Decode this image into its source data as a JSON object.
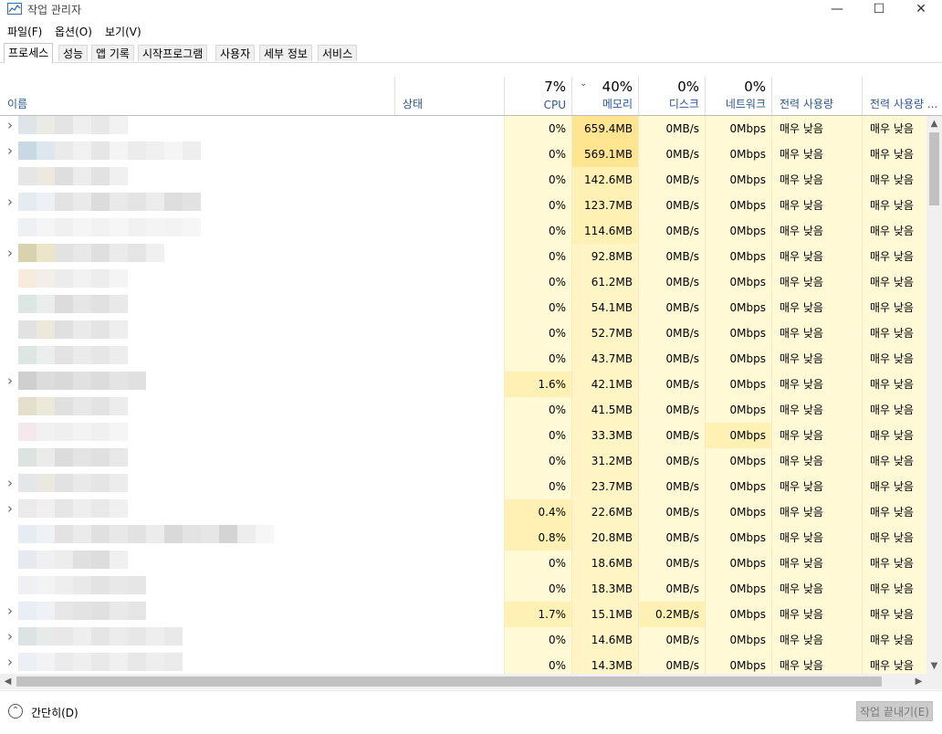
{
  "window": {
    "title": "작업 관리자"
  },
  "menu": [
    "파일(F)",
    "옵션(O)",
    "보기(V)"
  ],
  "tabs": [
    "프로세스",
    "성능",
    "앱 기록",
    "시작프로그램",
    "사용자",
    "세부 정보",
    "서비스"
  ],
  "active_tab": 0,
  "columns": {
    "name": "이름",
    "status": "상태",
    "cpu": {
      "pct": "7%",
      "label": "CPU"
    },
    "memory": {
      "pct": "40%",
      "label": "메모리"
    },
    "disk": {
      "pct": "0%",
      "label": "디스크"
    },
    "network": {
      "pct": "0%",
      "label": "네트워크"
    },
    "power": "전력 사용량",
    "power_trend": "전력 사용량 ..."
  },
  "rows": [
    {
      "expand": true,
      "cpu": "0%",
      "mem": "659.4MB",
      "disk": "0MB/s",
      "net": "0Mbps",
      "power": "매우 낮음",
      "trend": "매우 낮음"
    },
    {
      "expand": true,
      "cpu": "0%",
      "mem": "569.1MB",
      "disk": "0MB/s",
      "net": "0Mbps",
      "power": "매우 낮음",
      "trend": "매우 낮음"
    },
    {
      "expand": false,
      "cpu": "0%",
      "mem": "142.6MB",
      "disk": "0MB/s",
      "net": "0Mbps",
      "power": "매우 낮음",
      "trend": "매우 낮음"
    },
    {
      "expand": true,
      "cpu": "0%",
      "mem": "123.7MB",
      "disk": "0MB/s",
      "net": "0Mbps",
      "power": "매우 낮음",
      "trend": "매우 낮음"
    },
    {
      "expand": false,
      "cpu": "0%",
      "mem": "114.6MB",
      "disk": "0MB/s",
      "net": "0Mbps",
      "power": "매우 낮음",
      "trend": "매우 낮음"
    },
    {
      "expand": true,
      "cpu": "0%",
      "mem": "92.8MB",
      "disk": "0MB/s",
      "net": "0Mbps",
      "power": "매우 낮음",
      "trend": "매우 낮음"
    },
    {
      "expand": false,
      "cpu": "0%",
      "mem": "61.2MB",
      "disk": "0MB/s",
      "net": "0Mbps",
      "power": "매우 낮음",
      "trend": "매우 낮음"
    },
    {
      "expand": false,
      "cpu": "0%",
      "mem": "54.1MB",
      "disk": "0MB/s",
      "net": "0Mbps",
      "power": "매우 낮음",
      "trend": "매우 낮음"
    },
    {
      "expand": false,
      "cpu": "0%",
      "mem": "52.7MB",
      "disk": "0MB/s",
      "net": "0Mbps",
      "power": "매우 낮음",
      "trend": "매우 낮음"
    },
    {
      "expand": false,
      "cpu": "0%",
      "mem": "43.7MB",
      "disk": "0MB/s",
      "net": "0Mbps",
      "power": "매우 낮음",
      "trend": "매우 낮음"
    },
    {
      "expand": true,
      "cpu": "1.6%",
      "mem": "42.1MB",
      "disk": "0MB/s",
      "net": "0Mbps",
      "power": "매우 낮음",
      "trend": "매우 낮음"
    },
    {
      "expand": false,
      "cpu": "0%",
      "mem": "41.5MB",
      "disk": "0MB/s",
      "net": "0Mbps",
      "power": "매우 낮음",
      "trend": "매우 낮음"
    },
    {
      "expand": false,
      "cpu": "0%",
      "mem": "33.3MB",
      "disk": "0MB/s",
      "net": "0Mbps",
      "power": "매우 낮음",
      "trend": "매우 낮음"
    },
    {
      "expand": false,
      "cpu": "0%",
      "mem": "31.2MB",
      "disk": "0MB/s",
      "net": "0Mbps",
      "power": "매우 낮음",
      "trend": "매우 낮음"
    },
    {
      "expand": true,
      "cpu": "0%",
      "mem": "23.7MB",
      "disk": "0MB/s",
      "net": "0Mbps",
      "power": "매우 낮음",
      "trend": "매우 낮음"
    },
    {
      "expand": true,
      "cpu": "0.4%",
      "mem": "22.6MB",
      "disk": "0MB/s",
      "net": "0Mbps",
      "power": "매우 낮음",
      "trend": "매우 낮음"
    },
    {
      "expand": false,
      "cpu": "0.8%",
      "mem": "20.8MB",
      "disk": "0MB/s",
      "net": "0Mbps",
      "power": "매우 낮음",
      "trend": "매우 낮음"
    },
    {
      "expand": false,
      "cpu": "0%",
      "mem": "18.6MB",
      "disk": "0MB/s",
      "net": "0Mbps",
      "power": "매우 낮음",
      "trend": "매우 낮음"
    },
    {
      "expand": false,
      "cpu": "0%",
      "mem": "18.3MB",
      "disk": "0MB/s",
      "net": "0Mbps",
      "power": "매우 낮음",
      "trend": "매우 낮음"
    },
    {
      "expand": true,
      "cpu": "1.7%",
      "mem": "15.1MB",
      "disk": "0.2MB/s",
      "net": "0Mbps",
      "power": "매우 낮음",
      "trend": "매우 낮음"
    },
    {
      "expand": true,
      "cpu": "0%",
      "mem": "14.6MB",
      "disk": "0MB/s",
      "net": "0Mbps",
      "power": "매우 낮음",
      "trend": "매우 낮음"
    },
    {
      "expand": true,
      "cpu": "0%",
      "mem": "14.3MB",
      "disk": "0MB/s",
      "net": "0Mbps",
      "power": "매우 낮음",
      "trend": "매우 낮음"
    }
  ],
  "footer": {
    "fewer_details": "간단히(D)",
    "end_task": "작업 끝내기(E)"
  },
  "colors": {
    "heat_light": "#fff9d6",
    "heat_mid": "#fff1b8",
    "heat_strong": "#ffe58f",
    "header_label": "#2b5797"
  }
}
